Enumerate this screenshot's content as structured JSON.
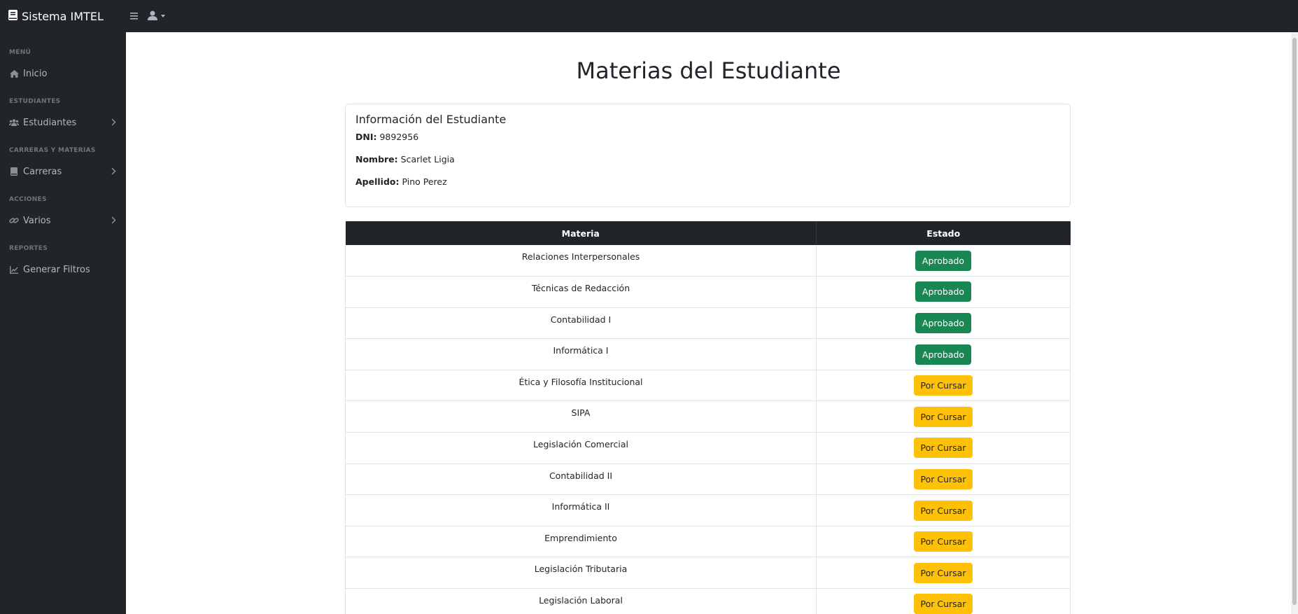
{
  "app": {
    "title": "Sistema IMTEL"
  },
  "sidebar": {
    "sections": [
      {
        "heading": "MENÚ",
        "items": [
          {
            "label": "Inicio",
            "icon": "home-icon",
            "has_chevron": false
          }
        ]
      },
      {
        "heading": "ESTUDIANTES",
        "items": [
          {
            "label": "Estudiantes",
            "icon": "users-icon",
            "has_chevron": true
          }
        ]
      },
      {
        "heading": "CARRERAS Y MATERIAS",
        "items": [
          {
            "label": "Carreras",
            "icon": "book-icon",
            "has_chevron": true
          }
        ]
      },
      {
        "heading": "ACCIONES",
        "items": [
          {
            "label": "Varios",
            "icon": "link-icon",
            "has_chevron": true
          }
        ]
      },
      {
        "heading": "REPORTES",
        "items": [
          {
            "label": "Generar Filtros",
            "icon": "chart-icon",
            "has_chevron": false
          }
        ]
      }
    ]
  },
  "page": {
    "title": "Materias del Estudiante"
  },
  "student": {
    "card_title": "Información del Estudiante",
    "dni_label": "DNI:",
    "dni": "9892956",
    "nombre_label": "Nombre:",
    "nombre": "Scarlet Ligia",
    "apellido_label": "Apellido:",
    "apellido": "Pino Perez"
  },
  "table": {
    "headers": [
      "Materia",
      "Estado"
    ],
    "rows": [
      {
        "materia": "Relaciones Interpersonales",
        "estado": "Aprobado"
      },
      {
        "materia": "Técnicas de Redacción",
        "estado": "Aprobado"
      },
      {
        "materia": "Contabilidad I",
        "estado": "Aprobado"
      },
      {
        "materia": "Informática I",
        "estado": "Aprobado"
      },
      {
        "materia": "Ética y Filosofía Institucional",
        "estado": "Por Cursar"
      },
      {
        "materia": "SIPA",
        "estado": "Por Cursar"
      },
      {
        "materia": "Legislación Comercial",
        "estado": "Por Cursar"
      },
      {
        "materia": "Contabilidad II",
        "estado": "Por Cursar"
      },
      {
        "materia": "Informática II",
        "estado": "Por Cursar"
      },
      {
        "materia": "Emprendimiento",
        "estado": "Por Cursar"
      },
      {
        "materia": "Legislación Tributaria",
        "estado": "Por Cursar"
      },
      {
        "materia": "Legislación Laboral",
        "estado": "Por Cursar"
      }
    ]
  },
  "colors": {
    "dark": "#212529",
    "approved": "#198754",
    "pending": "#ffc107"
  }
}
